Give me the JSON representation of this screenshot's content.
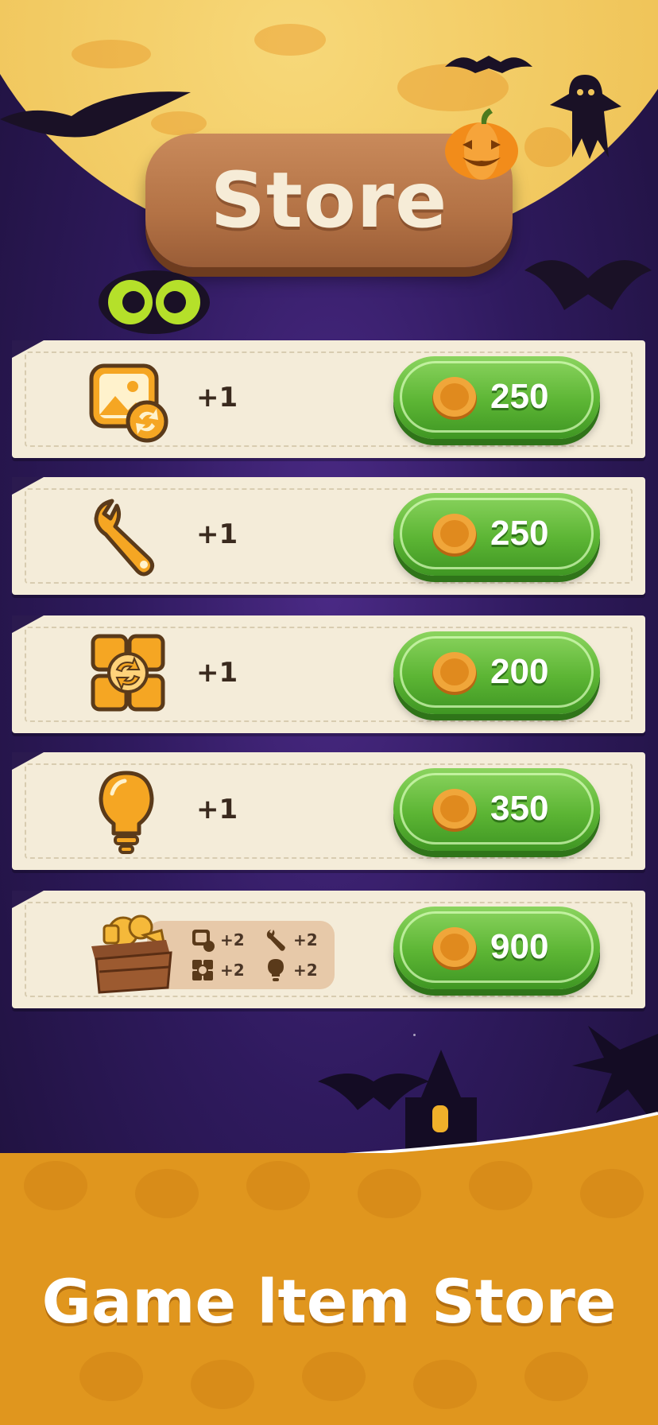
{
  "header": {
    "title": "Store"
  },
  "items": [
    {
      "icon": "image-swap-icon",
      "quantity": "+1",
      "price": "250"
    },
    {
      "icon": "wrench-icon",
      "quantity": "+1",
      "price": "250"
    },
    {
      "icon": "shuffle-icon",
      "quantity": "+1",
      "price": "200"
    },
    {
      "icon": "lightbulb-icon",
      "quantity": "+1",
      "price": "350"
    }
  ],
  "bundle": {
    "icon": "treasure-box-icon",
    "contents": [
      {
        "icon": "image-swap-icon",
        "quantity": "+2"
      },
      {
        "icon": "wrench-icon",
        "quantity": "+2"
      },
      {
        "icon": "shuffle-icon",
        "quantity": "+2"
      },
      {
        "icon": "lightbulb-icon",
        "quantity": "+2"
      }
    ],
    "price": "900"
  },
  "footer": {
    "caption": "Game ltem Store"
  },
  "colors": {
    "button_green": "#5cb534",
    "card_bg": "#f4ecd9",
    "plaque_brown": "#b37245",
    "footer_orange": "#e0961e",
    "icon_orange": "#f5a623"
  }
}
